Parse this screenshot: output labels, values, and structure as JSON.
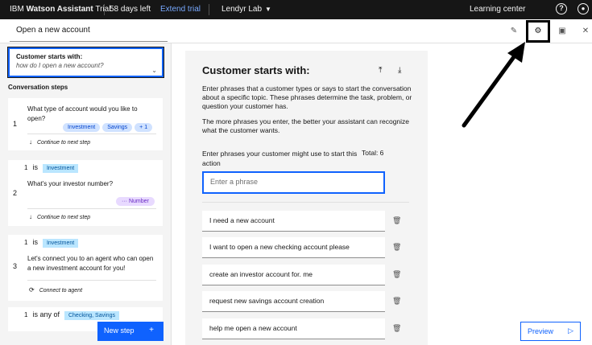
{
  "topbar": {
    "brand_ibm": "IBM",
    "brand_product": "Watson Assistant",
    "brand_trial": "Trial",
    "days_left": "58 days left",
    "extend_trial": "Extend trial",
    "workspace": "Lendyr Lab",
    "learning_center": "Learning center",
    "help_icon": "?",
    "user_icon": "user-icon"
  },
  "action": {
    "name": "Open a new account"
  },
  "left": {
    "customer_starts_title": "Customer starts with:",
    "customer_starts_example": "how do I open a new account?",
    "conversation_steps_label": "Conversation steps",
    "steps": [
      {
        "number": "1",
        "question": "What type of account would you like to open?",
        "options": [
          "Investment",
          "Savings",
          "+ 1"
        ],
        "continue": "Continue to next step"
      },
      {
        "number": "2",
        "condition_var": "1",
        "condition_op": "is",
        "condition_value": "Investment",
        "question": "What's your investor number?",
        "response_type": "Number",
        "continue": "Continue to next step"
      },
      {
        "number": "3",
        "condition_var": "1",
        "condition_op": "is",
        "condition_value": "Investment",
        "question": "Let's connect you to an agent who can open a new investment account for you!",
        "continue": "Connect to agent"
      },
      {
        "condition_var": "1",
        "condition_op": "is any of",
        "condition_value": "Checking, Savings"
      }
    ],
    "new_step_label": "New step"
  },
  "center": {
    "title": "Customer starts with:",
    "desc1": "Enter phrases that a customer types or says to start the conversation about a specific topic. These phrases determine the task, problem, or question your customer has.",
    "desc2": "The more phrases you enter, the better your assistant can recognize what the customer wants.",
    "enter_label": "Enter phrases your customer might use to start this action",
    "total": "Total: 6",
    "input_placeholder": "Enter a phrase",
    "phrases": [
      "I need a new account",
      "I want to open a new checking account please",
      "create an investor account for. me",
      "request new savings account creation",
      "help me open a new account"
    ]
  },
  "preview_label": "Preview",
  "colors": {
    "accent": "#0f62fe",
    "topbar_bg": "#161616",
    "tag_blue": "#d0e2ff",
    "tag_purple": "#e8daff"
  }
}
